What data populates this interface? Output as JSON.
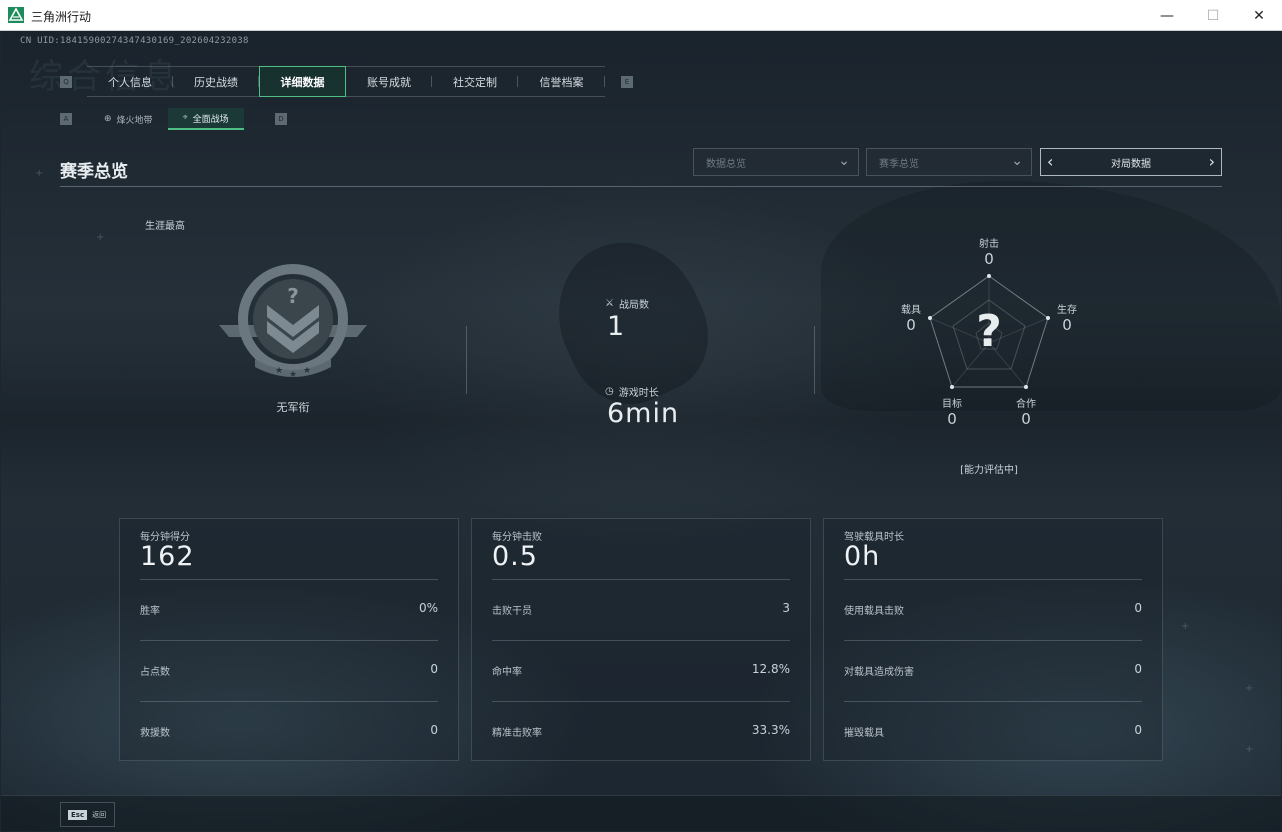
{
  "window": {
    "title": "三角洲行动",
    "min": "—",
    "max": "☐",
    "close": "✕"
  },
  "uid": "CN UID:18415900274347430169_202604232038",
  "ghost_title": "综合信息",
  "key_hints": {
    "left_tab": "Q",
    "right_tab": "E",
    "left_sub": "A",
    "right_sub": "D"
  },
  "tabs": [
    {
      "label": "个人信息"
    },
    {
      "label": "历史战绩"
    },
    {
      "label": "详细数据",
      "active": true
    },
    {
      "label": "账号成就"
    },
    {
      "label": "社交定制"
    },
    {
      "label": "信誉档案"
    }
  ],
  "subtabs": [
    {
      "label": "烽火地带",
      "icon": "globe-icon"
    },
    {
      "label": "全面战场",
      "icon": "crosshair-icon",
      "active": true
    }
  ],
  "section": {
    "title": "赛季总览",
    "dropdown1": "数据总览",
    "dropdown2": "赛季总览",
    "pager": "对局数据"
  },
  "career": {
    "label": "生涯最高",
    "rank": "无军衔",
    "emblem_mark": "?"
  },
  "match_stats": {
    "matches_label": "战局数",
    "matches_value": "1",
    "time_label": "游戏时长",
    "time_value": "6min"
  },
  "radar": {
    "center_mark": "?",
    "axes": [
      {
        "label": "射击",
        "value": "0"
      },
      {
        "label": "生存",
        "value": "0"
      },
      {
        "label": "合作",
        "value": "0"
      },
      {
        "label": "目标",
        "value": "0"
      },
      {
        "label": "载具",
        "value": "0"
      }
    ],
    "status": "[能力评估中]"
  },
  "cards": [
    {
      "label": "每分钟得分",
      "value": "162",
      "rows": [
        {
          "label": "胜率",
          "value": "0%"
        },
        {
          "label": "占点数",
          "value": "0"
        },
        {
          "label": "救援数",
          "value": "0"
        }
      ]
    },
    {
      "label": "每分钟击败",
      "value": "0.5",
      "rows": [
        {
          "label": "击败干员",
          "value": "3"
        },
        {
          "label": "命中率",
          "value": "12.8%"
        },
        {
          "label": "精准击败率",
          "value": "33.3%"
        }
      ]
    },
    {
      "label": "驾驶载具时长",
      "value": "0h",
      "rows": [
        {
          "label": "使用载具击败",
          "value": "0"
        },
        {
          "label": "对载具造成伤害",
          "value": "0"
        },
        {
          "label": "摧毁载具",
          "value": "0"
        }
      ]
    }
  ],
  "footer": {
    "key": "Esc",
    "label": "返回"
  },
  "colors": {
    "accent": "#4fbf86",
    "bg": "#1b2630",
    "text": "#c9d2d9"
  }
}
